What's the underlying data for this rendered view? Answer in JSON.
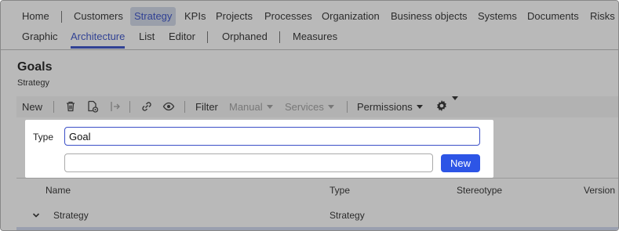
{
  "nav_primary": [
    {
      "label": "Home"
    },
    {
      "label": "Customers"
    },
    {
      "label": "Strategy"
    },
    {
      "label": "KPIs"
    },
    {
      "label": "Projects"
    },
    {
      "label": "Processes"
    },
    {
      "label": "Organization"
    },
    {
      "label": "Business objects"
    },
    {
      "label": "Systems"
    },
    {
      "label": "Documents"
    },
    {
      "label": "Risks"
    }
  ],
  "nav_secondary": [
    {
      "label": "Graphic"
    },
    {
      "label": "Architecture"
    },
    {
      "label": "List"
    },
    {
      "label": "Editor"
    },
    {
      "label": "Orphaned"
    },
    {
      "label": "Measures"
    }
  ],
  "page": {
    "title": "Goals",
    "subtitle": "Strategy"
  },
  "toolbar": {
    "new_label": "New",
    "filter_label": "Filter",
    "manual_label": "Manual",
    "services_label": "Services",
    "permissions_label": "Permissions"
  },
  "popup": {
    "type_label": "Type",
    "type_value": "Goal",
    "name_value": "",
    "new_button_label": "New"
  },
  "table": {
    "columns": [
      "Name",
      "Type",
      "Stereotype",
      "Version"
    ],
    "rows": [
      {
        "name": "Strategy",
        "type": "Strategy"
      }
    ]
  },
  "colors": {
    "accent": "#2b45c6",
    "button_primary": "#2d55e6",
    "overlay": "#5a5a5a"
  }
}
